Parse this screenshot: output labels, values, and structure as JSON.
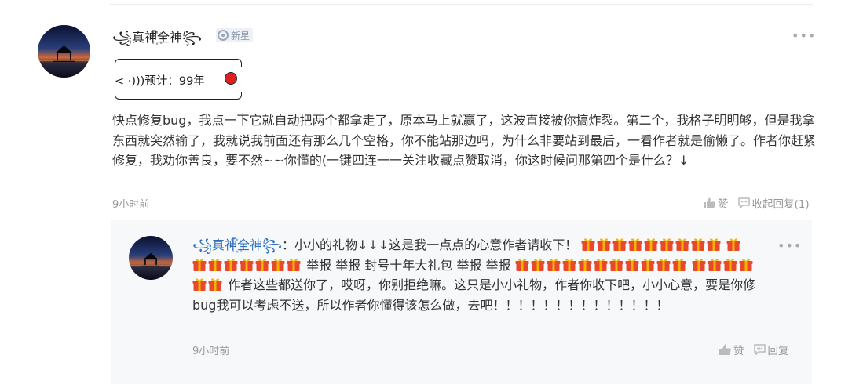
{
  "comment": {
    "username": "꧁真神ᩚ꙰ᩚ全神꧂",
    "badge_label": "新星",
    "signature": "< ·)))预计：99年",
    "text": "快点修复bug，我点一下它就自动把两个都拿走了，原本马上就赢了，这波直接被你搞炸裂。第二个，我格子明明够，但是我拿东西就突然输了，我就说我前面还有那么几个空格，你不能站那边吗，为什么非要站到最后，一看作者就是偷懒了。作者你赶紧修复，我劝你善良，要不然~~你懂的(一键四连一一关注收藏点赞取消，你这时候问那第四个是什么？↓",
    "time": "9小时前",
    "like_label": "赞",
    "collapse_label": "收起回复(1)",
    "more_icon": "more-dots-icon"
  },
  "reply": {
    "username": "꧁真神ᩚ꙰ᩚ全神꧂",
    "colon": "：",
    "seg1": "小小的礼物↓↓↓这是我一点点的心意作者请收下！",
    "seg2": "举报 举报 封号十年大礼包 举报 举报",
    "seg3": "作者这些都送你了，哎呀，你别拒绝嘛。这只是小小礼物，作者你收下吧，小小心意，要是你修bug我可以考虑不送，所以作者你懂得该怎么做，去吧！！！！！！！！！！！！！！",
    "time": "9小时前",
    "like_label": "赞",
    "reply_label": "回复"
  },
  "colors": {
    "reply_name": "#2e6fc4",
    "gift_red": "#e8492e",
    "gift_yellow": "#f5b400",
    "panel_bg": "#f7f8fa"
  }
}
